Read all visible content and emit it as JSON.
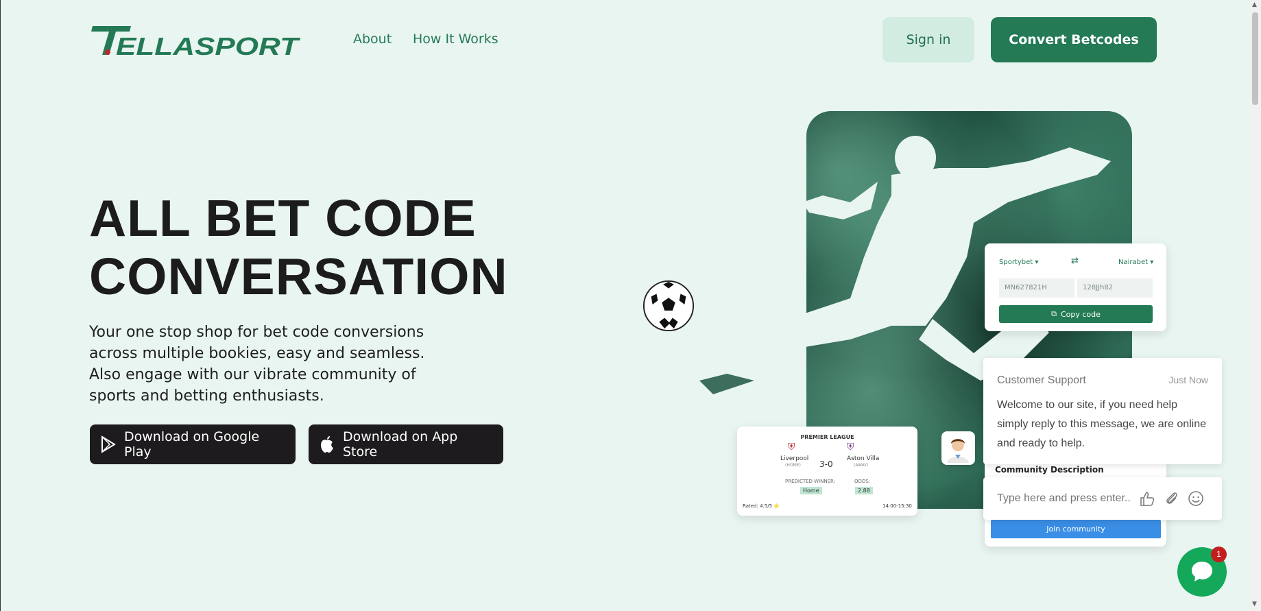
{
  "header": {
    "logo_text": "TELLASPORT",
    "nav": [
      "About",
      "How It Works"
    ],
    "signin_label": "Sign in",
    "convert_label": "Convert Betcodes"
  },
  "hero": {
    "headline_line1": "ALL BET CODE",
    "headline_line2": "CONVERSATION",
    "subtext": "Your one stop shop for bet code conversions across multiple bookies, easy and seamless. Also engage with our vibrate community of sports and betting enthusiasts.",
    "google_play_label": "Download on Google Play",
    "app_store_label": "Download on App Store"
  },
  "code_card": {
    "from_bookie": "Sportybet",
    "to_bookie": "Nairabet",
    "from_code": "MN6278​21H",
    "to_code": "128JJh82",
    "copy_label": "Copy code"
  },
  "match_card": {
    "league": "PREMIER LEAGUE",
    "home_team": "Liverpool",
    "home_tag": "(HOME)",
    "away_team": "Aston Villa",
    "away_tag": "(AWAY)",
    "score": "3-0",
    "predicted_label": "PREDICTED WINNER:",
    "predicted_value": "Home",
    "odds_label": "ODDS:",
    "odds_value": "2.88",
    "rating": "Rated: 4.5/5 ⭐",
    "time": "14:00-15:30"
  },
  "community": {
    "title": "Community Description",
    "join_label": "Join community"
  },
  "chat": {
    "from": "Customer Support",
    "time": "Just Now",
    "message": "Welcome to our site, if you need help simply reply to this message, we are online and ready to help.",
    "input_placeholder": "Type here and press enter..",
    "unread_count": "1"
  },
  "colors": {
    "background": "#e9f5f1",
    "brand_green": "#237a55",
    "brand_red": "#c0272d",
    "dark_button": "#1d1b1d",
    "chat_green": "#14a85a",
    "join_blue": "#3a8ee6"
  }
}
